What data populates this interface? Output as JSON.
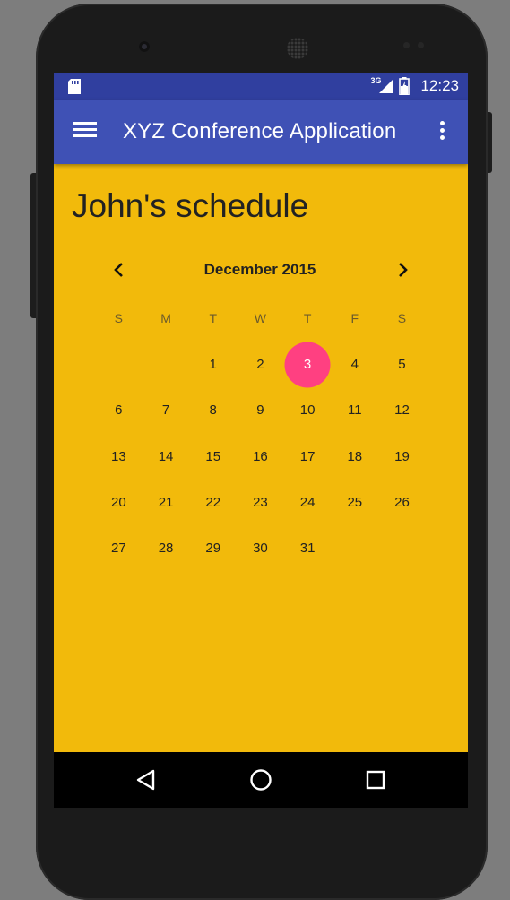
{
  "status_bar": {
    "network_label": "3G",
    "time": "12:23"
  },
  "app_bar": {
    "title": "XYZ Conference Application"
  },
  "page": {
    "title": "John's schedule"
  },
  "calendar": {
    "month_label": "December 2015",
    "weekdays": [
      "S",
      "M",
      "T",
      "W",
      "T",
      "F",
      "S"
    ],
    "days": [
      "",
      "",
      "1",
      "2",
      "3",
      "4",
      "5",
      "6",
      "7",
      "8",
      "9",
      "10",
      "11",
      "12",
      "13",
      "14",
      "15",
      "16",
      "17",
      "18",
      "19",
      "20",
      "21",
      "22",
      "23",
      "24",
      "25",
      "26",
      "27",
      "28",
      "29",
      "30",
      "31"
    ],
    "selected_day": "3"
  },
  "colors": {
    "status_bar": "#303F9F",
    "app_bar": "#3F51B5",
    "background": "#F2BA0B",
    "selected": "#FF4081"
  },
  "icons": {
    "status": [
      "sd-card-icon",
      "signal-icon",
      "battery-icon"
    ],
    "app_bar": [
      "menu-icon",
      "more-vert-icon"
    ],
    "calendar": [
      "chevron-left-icon",
      "chevron-right-icon"
    ],
    "nav": [
      "back-icon",
      "home-icon",
      "recents-icon"
    ]
  }
}
